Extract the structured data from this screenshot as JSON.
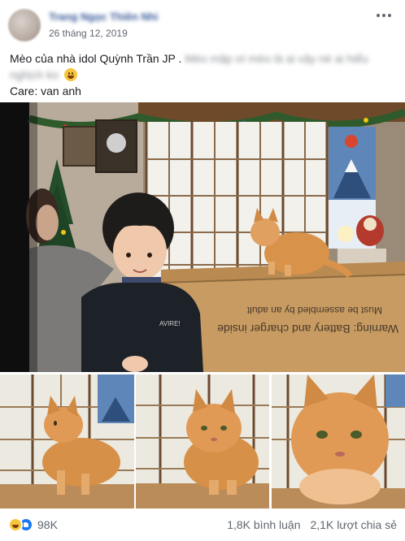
{
  "post": {
    "author": "Trang Ngọc Thiên Nhi",
    "date": "26 tháng 12, 2019",
    "caption_main": "Mèo của nhà idol Quỳnh Trần JP .",
    "caption_blurred_1": "Mèo mập ơi mèo là ai vậy nè ai hiểu",
    "caption_blurred_2": "nghịch ko",
    "care_line": "Care: van anh"
  },
  "main_photo": {
    "box_text_1": "Warning: Battery and charger inside",
    "box_text_2": "Must be assembled by an adult",
    "shirt_text": "AVIRE!"
  },
  "footer": {
    "reaction_count": "98K",
    "comments": "1,8K bình luận",
    "shares": "2,1K lượt chia sẻ"
  },
  "colors": {
    "link_blue": "#385898",
    "meta_grey": "#616770",
    "like_blue": "#1877f2",
    "haha_yellow": "#f7c53a"
  },
  "icons": [
    "more-options-icon",
    "haha-reaction-icon",
    "like-reaction-icon",
    "smile-emoji-icon"
  ]
}
